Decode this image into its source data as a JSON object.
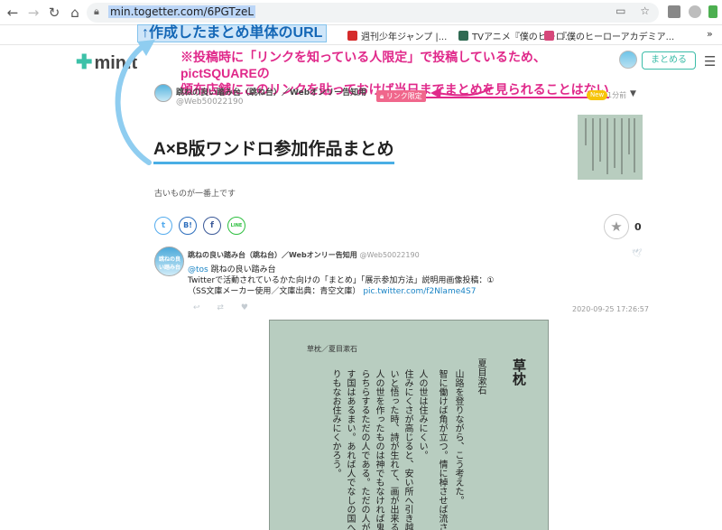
{
  "browser": {
    "url": "min.togetter.com/6PGTzeL",
    "bookmarks": [
      {
        "label": "週刊少年ジャンプ |...",
        "color": "#d52b2b"
      },
      {
        "label": "TVアニメ『僕のヒーロ...",
        "color": "#2f6a52"
      },
      {
        "label": "『僕のヒーローアカデミア...",
        "color": "#d6487a"
      }
    ],
    "more_bookmarks": "»"
  },
  "annotations": {
    "url_note": "↑作成したまとめ単体のURL",
    "pink_line1": "※投稿時に「リンクを知っている人限定」で投稿しているため、pictSQUAREの",
    "pink_line2_pre": "頒布店舗にこのリンクを貼っておけば",
    "pink_line2_hl": "当日までまとめを見られることはない"
  },
  "site": {
    "logo": "min.t",
    "matome_button": "まとめる"
  },
  "article": {
    "author_name": "跳ねの良い踏み台（跳ね台）／Webオンリー告知用",
    "author_handle": "@Web50022190",
    "link_badge": "リンク限定",
    "new_badge": "New",
    "time_ago": "1分前",
    "title": "A×B版ワンドロ参加作品まとめ",
    "description": "古いものが一番上です",
    "fav_count": "0"
  },
  "share": {
    "twitter": "t",
    "hatena": "B!",
    "facebook": "f",
    "line": "LINE"
  },
  "tweet": {
    "name": "跳ねの良い踏み台（跳ね台）／Webオンリー告知用",
    "handle": "@Web50022190",
    "mention": "@tos",
    "line1_rest": " 跳ねの良い踏み台",
    "line2": "Twitterで活動されているかた向けの「まとめ」「展示参加方法」説明用画像投稿：①",
    "line3": "（SS文庫メーカー使用／文庫出典：青空文庫）",
    "link": "pic.twitter.com/f2Nlame4S7",
    "time": "2020-09-25 17:26:57",
    "avatar_text": "跳ねの良い踏み台"
  },
  "book_image": {
    "label": "草枕／夏目漱石",
    "title": "草枕",
    "author": "夏目漱石",
    "lines": [
      "山路を登りながら、こう考えた。",
      "智に働けば角が立つ。情に棹させば流さ",
      "人の世は住みにくい。",
      "住みにくさが高じると、安い所へ引き越",
      "いと悟った時、詩が生れて、画が出来る。",
      "人の世を作ったものは神でもなければ鬼",
      "らちらするただの人である。ただの人が作",
      "す国はあるまい。あれば人でなしの国へ行",
      "りもなお住みにくかろう。"
    ]
  },
  "colors": {
    "accent_blue": "#4aaee5",
    "accent_pink": "#e0288a",
    "brand_green": "#3cbca8"
  }
}
